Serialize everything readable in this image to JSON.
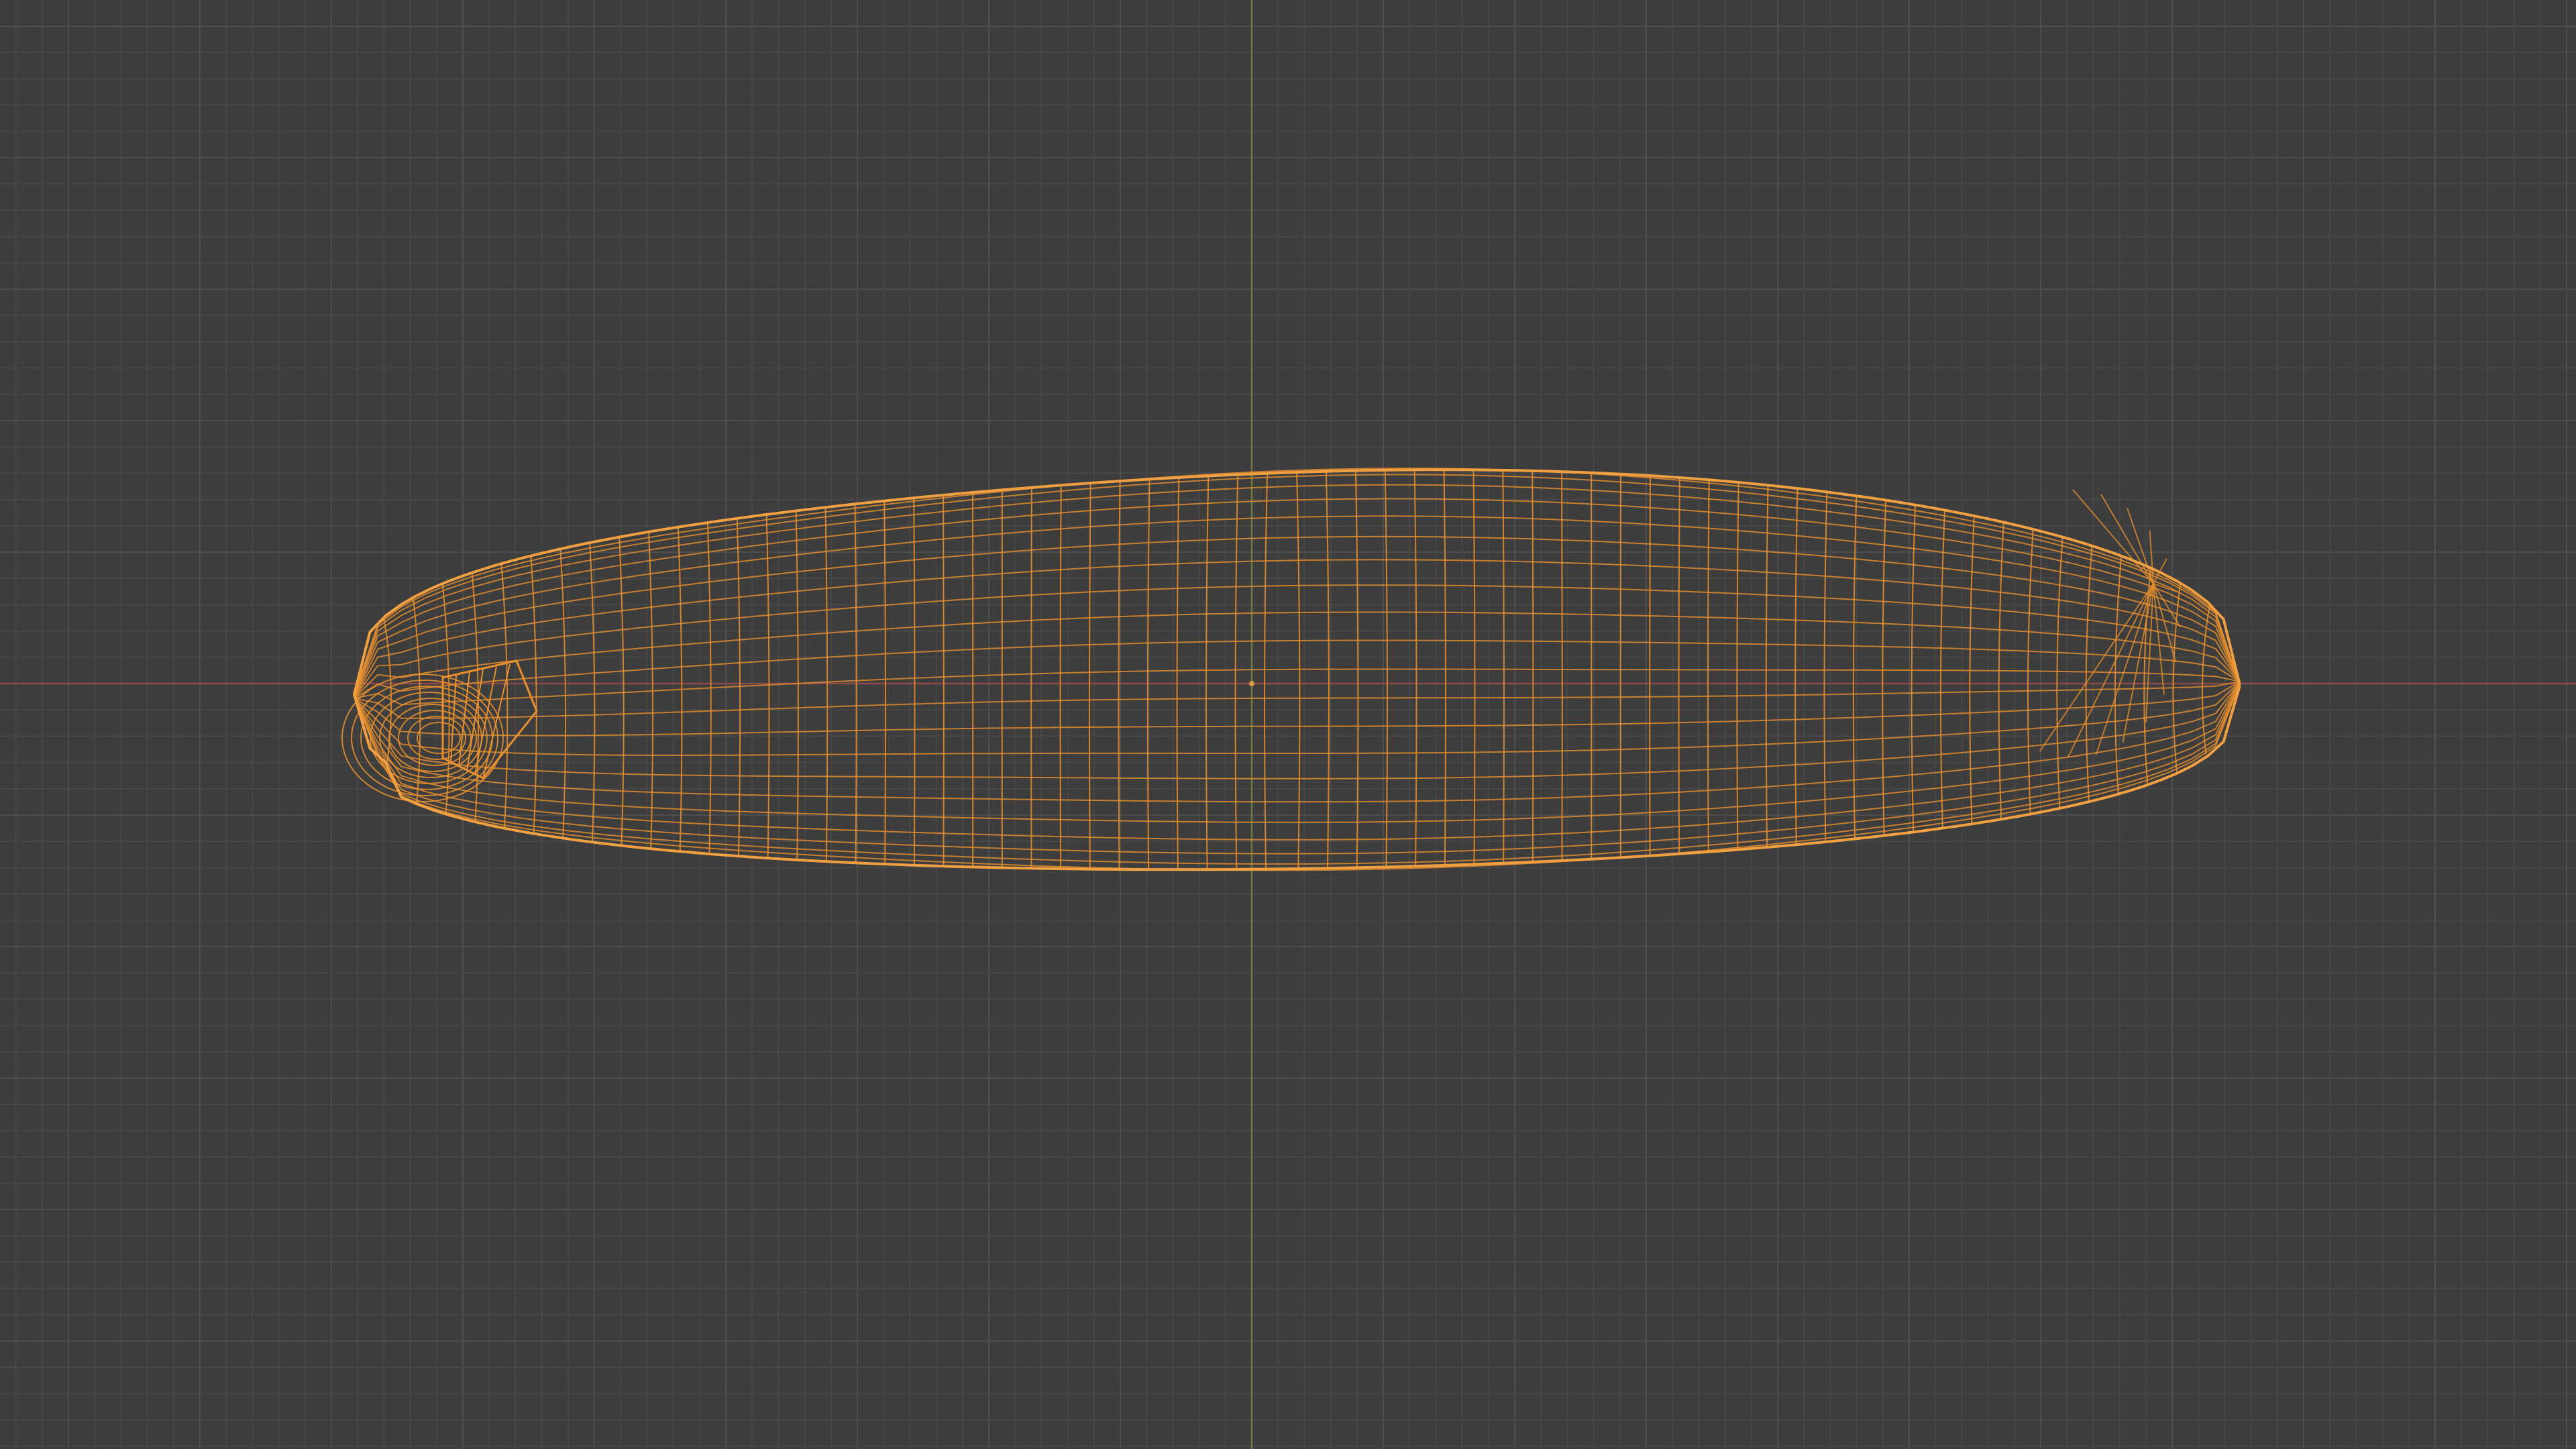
{
  "viewport": {
    "background": "#3d3d3d",
    "grid_minor_color": "#474747",
    "grid_major_color": "#4e4e4e",
    "x_axis_color": "#8a4a4a",
    "y_axis_color": "#6b7a3e"
  },
  "object": {
    "shape": "elongated mesh (zucchini-like)",
    "display_mode": "wireframe",
    "selected": true,
    "wire_color": "#e8902e",
    "outline_color": "#f0a040"
  },
  "origin": {
    "color": "#d89a40"
  }
}
